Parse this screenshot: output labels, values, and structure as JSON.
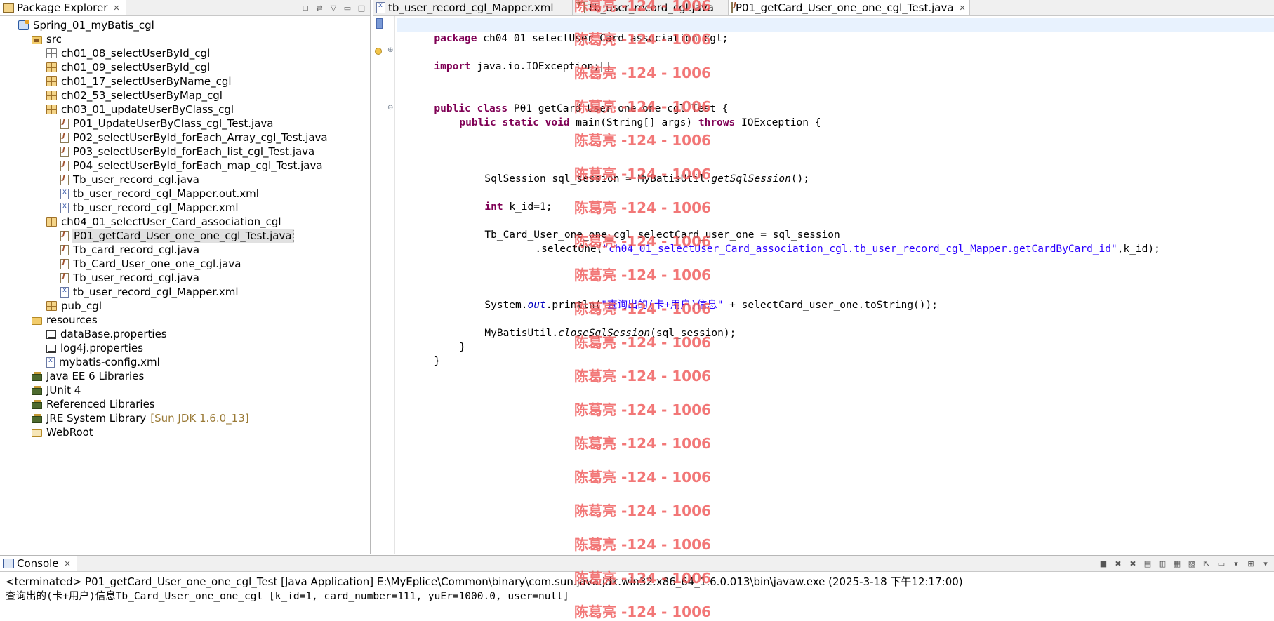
{
  "explorer": {
    "title": "Package Explorer",
    "items": [
      {
        "label": "Spring_01_myBatis_cgl",
        "icon": "project-icon"
      },
      {
        "label": "src",
        "icon": "source-folder-icon"
      },
      {
        "label": "ch01_08_selectUserById_cgl",
        "icon": "empty-package-icon"
      },
      {
        "label": "ch01_09_selectUserById_cgl",
        "icon": "package-icon"
      },
      {
        "label": "ch01_17_selectUserByName_cgl",
        "icon": "package-icon"
      },
      {
        "label": "ch02_53_selectUserByMap_cgl",
        "icon": "package-icon"
      },
      {
        "label": "ch03_01_updateUserByClass_cgl",
        "icon": "package-icon"
      },
      {
        "label": "P01_UpdateUserByClass_cgl_Test.java",
        "icon": "java-file-icon"
      },
      {
        "label": "P02_selectUserById_forEach_Array_cgl_Test.java",
        "icon": "java-file-icon"
      },
      {
        "label": "P03_selectUserById_forEach_list_cgl_Test.java",
        "icon": "java-file-icon"
      },
      {
        "label": "P04_selectUserById_forEach_map_cgl_Test.java",
        "icon": "java-file-icon"
      },
      {
        "label": "Tb_user_record_cgl.java",
        "icon": "java-file-icon"
      },
      {
        "label": "tb_user_record_cgl_Mapper.out.xml",
        "icon": "xml-file-icon"
      },
      {
        "label": "tb_user_record_cgl_Mapper.xml",
        "icon": "xml-file-icon"
      },
      {
        "label": "ch04_01_selectUser_Card_association_cgl",
        "icon": "package-icon"
      },
      {
        "label": "P01_getCard_User_one_one_cgl_Test.java",
        "icon": "java-file-icon"
      },
      {
        "label": "Tb_card_record_cgl.java",
        "icon": "java-file-icon"
      },
      {
        "label": "Tb_Card_User_one_one_cgl.java",
        "icon": "java-file-icon"
      },
      {
        "label": "Tb_user_record_cgl.java",
        "icon": "java-file-icon"
      },
      {
        "label": "tb_user_record_cgl_Mapper.xml",
        "icon": "xml-file-icon"
      },
      {
        "label": "pub_cgl",
        "icon": "package-icon"
      },
      {
        "label": "resources",
        "icon": "folder-icon"
      },
      {
        "label": "dataBase.properties",
        "icon": "properties-file-icon"
      },
      {
        "label": "log4j.properties",
        "icon": "properties-file-icon"
      },
      {
        "label": "mybatis-config.xml",
        "icon": "xml-file-icon"
      },
      {
        "label": "Java EE 6 Libraries",
        "icon": "library-icon"
      },
      {
        "label": "JUnit 4",
        "icon": "library-icon"
      },
      {
        "label": "Referenced Libraries",
        "icon": "library-icon"
      },
      {
        "label": "JRE System Library",
        "icon": "library-icon",
        "note": "[Sun JDK 1.6.0_13]"
      },
      {
        "label": "WebRoot",
        "icon": "folder-icon"
      }
    ]
  },
  "editor": {
    "tabs": [
      {
        "label": "tb_user_record_cgl_Mapper.xml"
      },
      {
        "label": "Tb_user_record_cgl.java"
      },
      {
        "label": "P01_getCard_User_one_one_cgl_Test.java",
        "active": true
      }
    ],
    "code": {
      "l1_kw": "package",
      "l1_rest": " ch04_01_selectUser_Card_association_cgl;",
      "l2_kw": "import",
      "l2_rest": " java.io.IOException;",
      "l3_kw": "public class",
      "l3_rest": " P01_getCard_User_one_one_cgl_Test {",
      "l4_kw": "public static void",
      "l4_mid": " main(String[] args) ",
      "l4_kw2": "throws",
      "l4_rest": " IOException {",
      "l5_pre": "SqlSession sql_session = MyBatisUtil.",
      "l5_method": "getSqlSession",
      "l5_post": "();",
      "l6_kw": "int",
      "l6_rest": " k_id=1;",
      "l7": "Tb_Card_User_one_one_cgl selectCard_user_one = sql_session",
      "l8_pre": ".selectOne(",
      "l8_str": "\"ch04_01_selectUser_Card_association_cgl.tb_user_record_cgl_Mapper.getCardByCard_id\"",
      "l8_post": ",k_id);",
      "l9_pre": "System.",
      "l9_field": "out",
      "l9_mid": ".println(",
      "l9_str": "\"查询出的(卡+用户)信息\"",
      "l9_post": " + selectCard_user_one.toString());",
      "l10_pre": "MyBatisUtil.",
      "l10_method": "closeSqlSession",
      "l10_post": "(sql_session);",
      "l11": "}",
      "l12": "}"
    }
  },
  "watermark": "陈葛亮 -124 - 1006",
  "console": {
    "title": "Console",
    "terminated": "<terminated> P01_getCard_User_one_one_cgl_Test [Java Application] E:\\MyEplice\\Common\\binary\\com.sun.java.jdk.win32.x86_64_1.6.0.013\\bin\\javaw.exe (2025-3-18 下午12:17:00)",
    "output": "查询出的(卡+用户)信息Tb_Card_User_one_one_cgl [k_id=1, card_number=111, yuEr=1000.0, user=null]"
  }
}
